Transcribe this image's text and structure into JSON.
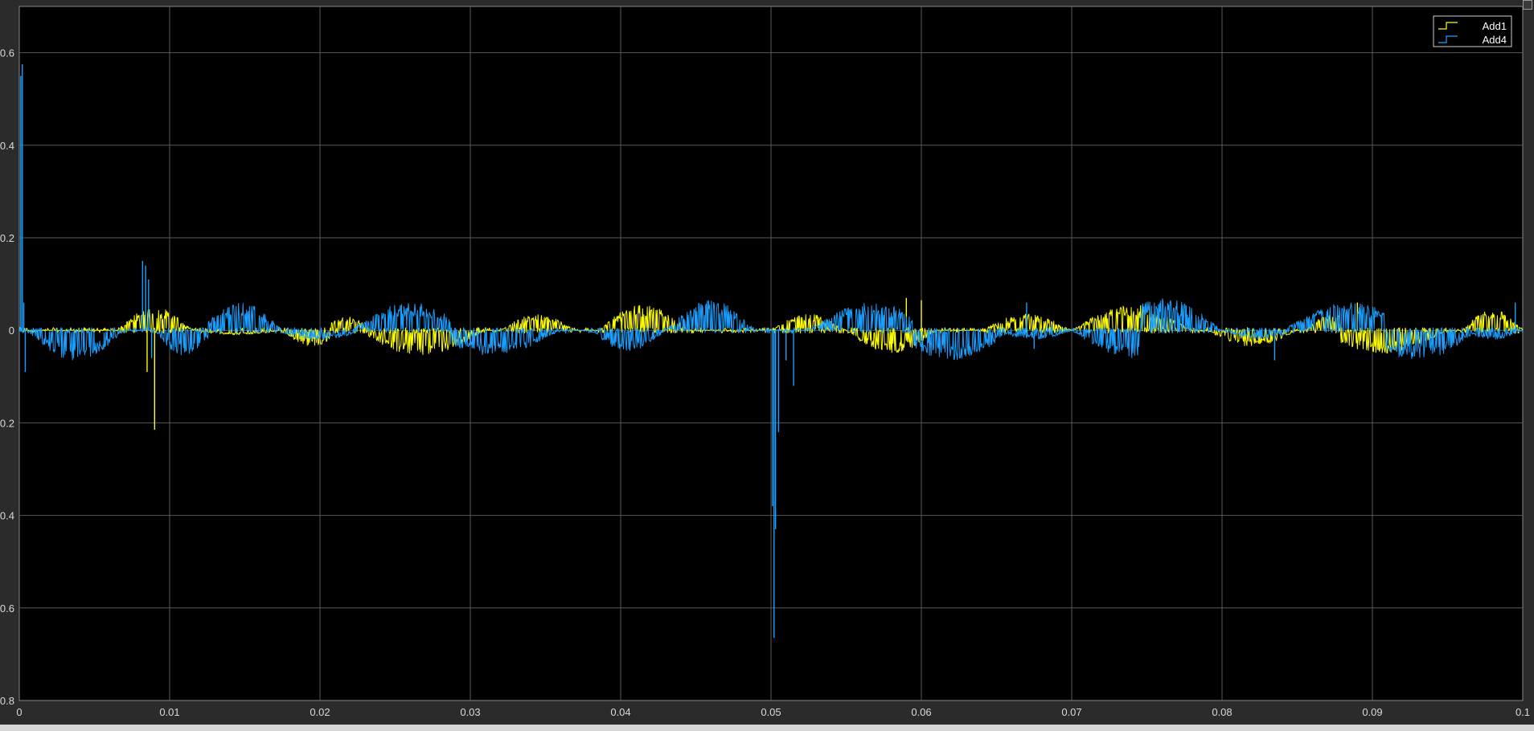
{
  "chart_data": {
    "type": "line",
    "xlim": [
      0,
      0.1
    ],
    "ylim": [
      -0.8,
      0.7
    ],
    "xticks": [
      "0",
      "0.01",
      "0.02",
      "0.03",
      "0.04",
      "0.05",
      "0.06",
      "0.07",
      "0.08",
      "0.09",
      "0.1"
    ],
    "xtick_values": [
      0,
      0.01,
      0.02,
      0.03,
      0.04,
      0.05,
      0.06,
      0.07,
      0.08,
      0.09,
      0.1
    ],
    "yticks": [
      "0.6",
      "0.4",
      "0.2",
      "0",
      "0.2",
      "0.4",
      "0.6",
      "0.8"
    ],
    "ytick_values": [
      0.6,
      0.4,
      0.2,
      0,
      -0.2,
      -0.4,
      -0.6,
      -0.8
    ],
    "grid": true,
    "legend_position": "top-right",
    "background": "#000000",
    "grid_color": "#5a5a5a",
    "series": [
      {
        "name": "Add1",
        "color": "#ffff00",
        "envelope_lobes": [
          {
            "t0": 0.0065,
            "t1": 0.0115,
            "peak": 0.05
          },
          {
            "t0": 0.0115,
            "t1": 0.0175,
            "peak": -0.01
          },
          {
            "t0": 0.0175,
            "t1": 0.0215,
            "peak": -0.035
          },
          {
            "t0": 0.02,
            "t1": 0.0235,
            "peak": 0.03
          },
          {
            "t0": 0.0225,
            "t1": 0.031,
            "peak": -0.055
          },
          {
            "t0": 0.032,
            "t1": 0.037,
            "peak": 0.035
          },
          {
            "t0": 0.0385,
            "t1": 0.0445,
            "peak": 0.055
          },
          {
            "t0": 0.05,
            "t1": 0.055,
            "peak": 0.035
          },
          {
            "t0": 0.055,
            "t1": 0.061,
            "peak": -0.05
          },
          {
            "t0": 0.064,
            "t1": 0.07,
            "peak": 0.035
          },
          {
            "t0": 0.07,
            "t1": 0.078,
            "peak": 0.055
          },
          {
            "t0": 0.079,
            "t1": 0.085,
            "peak": -0.035
          },
          {
            "t0": 0.0855,
            "t1": 0.089,
            "peak": 0.035
          },
          {
            "t0": 0.086,
            "t1": 0.095,
            "peak": -0.05
          },
          {
            "t0": 0.096,
            "t1": 0.1,
            "peak": 0.045
          }
        ],
        "spikes": [
          {
            "t": 0.0085,
            "y": -0.09
          },
          {
            "t": 0.009,
            "y": -0.215
          },
          {
            "t": 0.059,
            "y": 0.07
          },
          {
            "t": 0.06,
            "y": 0.065
          },
          {
            "t": 0.089,
            "y": 0.06
          }
        ]
      },
      {
        "name": "Add4",
        "color": "#1a9fff",
        "envelope_lobes": [
          {
            "t0": 0.0005,
            "t1": 0.007,
            "peak": -0.065
          },
          {
            "t0": 0.009,
            "t1": 0.013,
            "peak": -0.055
          },
          {
            "t0": 0.012,
            "t1": 0.0175,
            "peak": 0.06
          },
          {
            "t0": 0.017,
            "t1": 0.023,
            "peak": -0.02
          },
          {
            "t0": 0.022,
            "t1": 0.03,
            "peak": 0.06
          },
          {
            "t0": 0.027,
            "t1": 0.036,
            "peak": -0.055
          },
          {
            "t0": 0.038,
            "t1": 0.043,
            "peak": -0.045
          },
          {
            "t0": 0.043,
            "t1": 0.049,
            "peak": 0.065
          },
          {
            "t0": 0.0525,
            "t1": 0.061,
            "peak": 0.06
          },
          {
            "t0": 0.058,
            "t1": 0.066,
            "peak": -0.065
          },
          {
            "t0": 0.065,
            "t1": 0.07,
            "peak": -0.02
          },
          {
            "t0": 0.072,
            "t1": 0.08,
            "peak": 0.07
          },
          {
            "t0": 0.07,
            "t1": 0.078,
            "peak": -0.06
          },
          {
            "t0": 0.08,
            "t1": 0.085,
            "peak": -0.02
          },
          {
            "t0": 0.084,
            "t1": 0.093,
            "peak": 0.06
          },
          {
            "t0": 0.089,
            "t1": 0.097,
            "peak": -0.065
          },
          {
            "t0": 0.096,
            "t1": 0.1,
            "peak": -0.02
          }
        ],
        "spikes": [
          {
            "t": 0.0001,
            "y": 0.55
          },
          {
            "t": 0.0002,
            "y": 0.575
          },
          {
            "t": 0.0003,
            "y": 0.06
          },
          {
            "t": 0.0004,
            "y": -0.09
          },
          {
            "t": 0.0082,
            "y": 0.15
          },
          {
            "t": 0.0084,
            "y": 0.14
          },
          {
            "t": 0.0086,
            "y": 0.11
          },
          {
            "t": 0.0088,
            "y": -0.06
          },
          {
            "t": 0.0501,
            "y": -0.38
          },
          {
            "t": 0.0502,
            "y": -0.665
          },
          {
            "t": 0.0503,
            "y": -0.43
          },
          {
            "t": 0.0505,
            "y": -0.22
          },
          {
            "t": 0.051,
            "y": -0.065
          },
          {
            "t": 0.0515,
            "y": -0.12
          },
          {
            "t": 0.067,
            "y": 0.06
          },
          {
            "t": 0.0675,
            "y": -0.04
          },
          {
            "t": 0.0835,
            "y": -0.065
          },
          {
            "t": 0.0995,
            "y": 0.06
          }
        ]
      }
    ]
  }
}
